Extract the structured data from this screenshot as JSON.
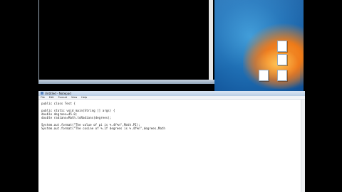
{
  "notepad": {
    "title": "Untitled - Notepad",
    "menu": [
      "File",
      "Edit",
      "Format",
      "View",
      "Help"
    ],
    "lines": [
      "public class Test {",
      "",
      "public static void main(String [] args) {",
      "double degrees=45.0;",
      "double radians=Math.toRadians(degrees);",
      "",
      "System.out.format(\"The value of pi is %.4f%n\",Math.PI);",
      "System.out.format(\"The cosine of %.1f degrees is %.4f%n\",degrees,Math"
    ]
  },
  "desktop": {
    "icons": [
      {
        "label": ""
      },
      {
        "label": ""
      },
      {
        "label": ""
      },
      {
        "label": ""
      }
    ]
  },
  "colors": {
    "wallpaper_blue": "#1f6fb4",
    "wallpaper_orange": "#ee7a16",
    "titlebar": "#b9cde4"
  }
}
